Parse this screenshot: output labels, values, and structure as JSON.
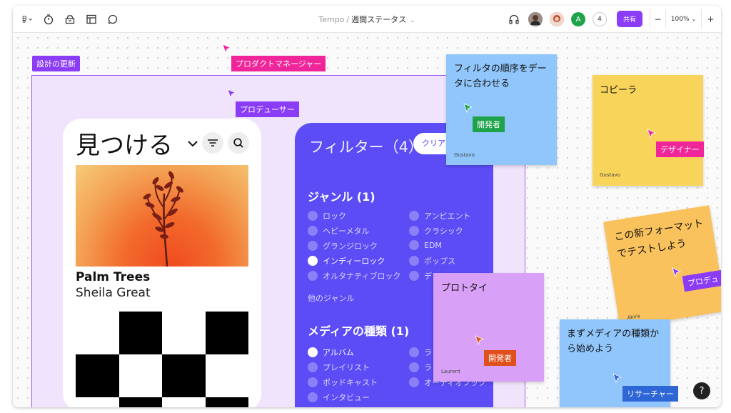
{
  "toolbar": {
    "icons": [
      "figma-menu-icon",
      "timer-icon",
      "library-icon",
      "layout-icon",
      "comment-icon"
    ],
    "project": "Tempo",
    "separator": "/",
    "file_name": "週間ステータス",
    "collaborators": [
      {
        "name": "avatar-dark",
        "color": "#5a4a42"
      },
      {
        "name": "avatar-woman",
        "color": "#c2553f"
      },
      {
        "name": "avatar-a",
        "initial": "A",
        "color": "#1fa34a"
      }
    ],
    "collaborator_count": "4",
    "share_label": "共有",
    "zoom_minus": "−",
    "zoom_level": "100%",
    "zoom_plus": "+"
  },
  "canvas": {
    "frame_label": "設計の更新",
    "cursor_labels": {
      "product_manager": "プロダクトマネージャー",
      "producer": "プロデューサー",
      "developer_1": "開発者",
      "designer": "デザイナー",
      "producer_2": "プロデュ",
      "developer_2": "開発者",
      "researcher": "リサーチャー"
    },
    "colors": {
      "pink": "#f0259a",
      "purple": "#8b3cf6",
      "green": "#1fa34a",
      "red": "#e0501c",
      "blue": "#2f66d6"
    }
  },
  "phone": {
    "title": "見つける",
    "track_title": "Palm Trees",
    "track_artist": "Sheila Great"
  },
  "filters": {
    "title": "フィルター（4）",
    "clear_label": "クリア",
    "genre_title": "ジャンル (1)",
    "genres_left": [
      {
        "label": "ロック",
        "checked": false
      },
      {
        "label": "ヘビーメタル",
        "checked": false
      },
      {
        "label": "グランジロック",
        "checked": false
      },
      {
        "label": "インディーロック",
        "checked": true
      },
      {
        "label": "オルタナティブロック",
        "checked": false
      }
    ],
    "genres_right": [
      {
        "label": "アンビエント",
        "checked": false
      },
      {
        "label": "クラシック",
        "checked": false
      },
      {
        "label": "EDM",
        "checked": false
      },
      {
        "label": "ポップス",
        "checked": false
      },
      {
        "label": "デ",
        "checked": false
      }
    ],
    "more_genres": "他のジャンル",
    "media_title": "メディアの種類 (1)",
    "media_left": [
      {
        "label": "アルバム",
        "checked": true
      },
      {
        "label": "プレイリスト",
        "checked": false
      },
      {
        "label": "ポッドキャスト",
        "checked": false
      },
      {
        "label": "インタビュー",
        "checked": false
      }
    ],
    "media_right": [
      {
        "label": "ラ",
        "checked": false
      },
      {
        "label": "ラ",
        "checked": false
      },
      {
        "label": "オーディオブック",
        "checked": false
      }
    ]
  },
  "stickies": {
    "filter_order": {
      "text": "フィルタの順序をデータに合わせる",
      "author": "Gustavo",
      "color": "#90c6fb"
    },
    "copy": {
      "text": "コピーラ",
      "author": "Gustavo",
      "color": "#f8d55a"
    },
    "test_format": {
      "text": "この新フォーマットでテストしよう",
      "author": "Akira",
      "color": "#f9c25c"
    },
    "prototype": {
      "text": "プロトタイ",
      "author": "Laurent",
      "color": "#d9a0f8"
    },
    "media_first": {
      "text": "まずメディアの種類から始めよう",
      "author": "",
      "color": "#90c6fb"
    }
  },
  "help_label": "?"
}
